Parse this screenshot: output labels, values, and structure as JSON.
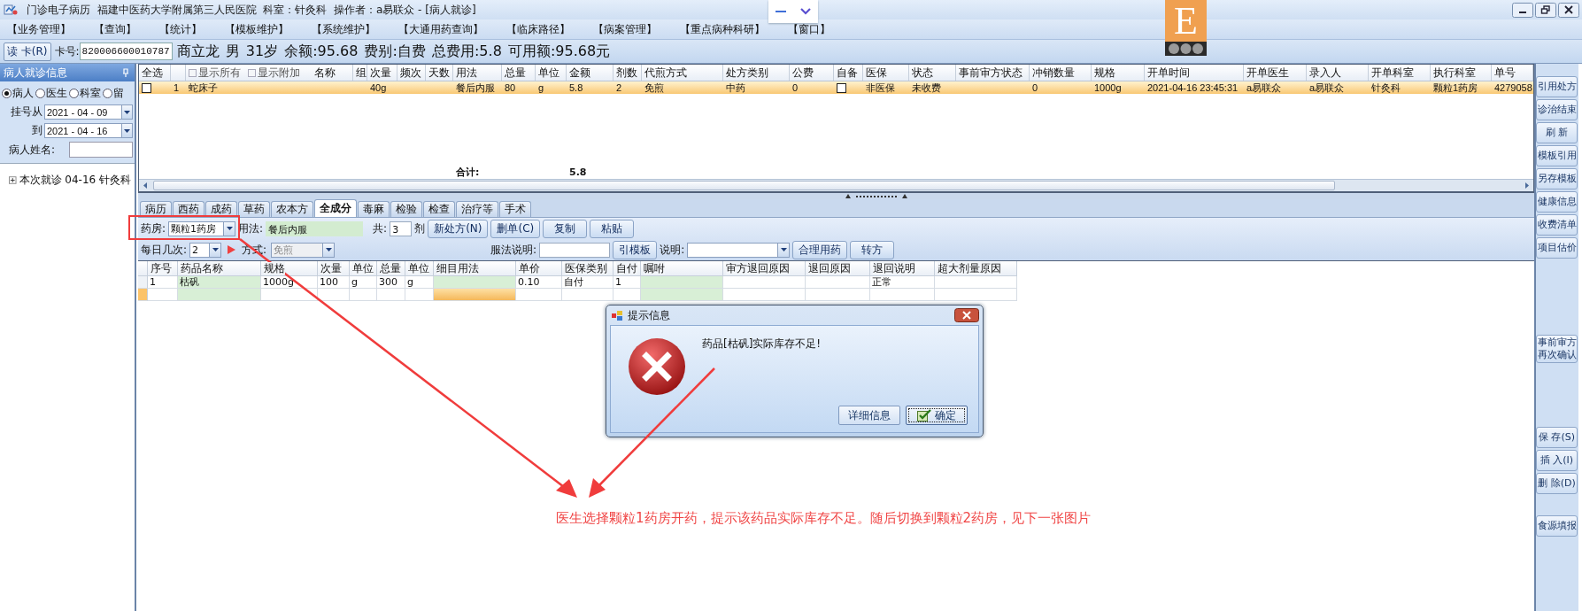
{
  "window": {
    "title": "门诊电子病历  福建中医药大学附属第三人民医院  科室：针灸科  操作者：a易联众 - [病人就诊]"
  },
  "menu": [
    "【业务管理】",
    "【查询】",
    "【统计】",
    "【模板维护】",
    "【系统维护】",
    "【大通用药查询】",
    "【临床路径】",
    "【病案管理】",
    "【重点病种科研】",
    "【窗口】"
  ],
  "logo": {
    "letter": "E"
  },
  "patient_bar": {
    "read_card_button": "读 卡(R)",
    "card_label": "卡号:",
    "card_number": "820006600010787",
    "summary": "商立龙 男 31岁 余额:95.68 费别:自费 总费用:5.8 可用额:95.68元"
  },
  "left_panel": {
    "title": "病人就诊信息",
    "filter": [
      {
        "label": "病人",
        "selected": true
      },
      {
        "label": "医生",
        "selected": false
      },
      {
        "label": "科室",
        "selected": false
      },
      {
        "label": "留",
        "selected": false
      }
    ],
    "date_from_label": "挂号从",
    "date_from": "2021 - 04 - 09",
    "date_to_label": "到",
    "date_to": "2021 - 04 - 16",
    "name_label": "病人姓名:",
    "visits": [
      {
        "label": "本次就诊 04-16 针灸科",
        "expanded": false
      }
    ]
  },
  "orders_table": {
    "header_checkboxes": [
      {
        "label": "显示所有",
        "checked": false
      },
      {
        "label": "显示附加",
        "checked": false
      }
    ],
    "columns": [
      "全选",
      null,
      "名称",
      "组",
      "次量",
      "频次",
      "天数",
      "用法",
      "总量",
      "单位",
      "金额",
      "剂数",
      "代煎方式",
      "处方类别",
      "公费",
      "自备",
      "医保",
      "状态",
      "事前审方状态",
      "冲销数量",
      "规格",
      "开单时间",
      "开单医生",
      "录入人",
      "开单科室",
      "执行科室",
      "单号"
    ],
    "rows": [
      {
        "selected": true,
        "cells": [
          {
            "kind": "checkbox",
            "checked": false
          },
          "1",
          "蛇床子",
          null,
          "40g",
          null,
          null,
          "餐后内服",
          "80",
          "g",
          "5.8",
          "2",
          "免煎",
          "中药",
          "0",
          {
            "kind": "checkbox",
            "checked": false
          },
          "非医保",
          "未收费",
          null,
          "0",
          "1000g",
          "2021-04-16 23:45:31",
          "a易联众",
          "a易联众",
          "针灸科",
          "颗粒1药房",
          "4279058"
        ]
      }
    ],
    "total_label": "合计:",
    "total_amount": "5.8"
  },
  "tabs": [
    {
      "label": "病历",
      "selected": false
    },
    {
      "label": "西药",
      "selected": false
    },
    {
      "label": "成药",
      "selected": false
    },
    {
      "label": "草药",
      "selected": false
    },
    {
      "label": "农本方",
      "selected": false
    },
    {
      "label": "全成分",
      "selected": true
    },
    {
      "label": "毒麻",
      "selected": false
    },
    {
      "label": "检验",
      "selected": false
    },
    {
      "label": "检查",
      "selected": false
    },
    {
      "label": "治疗等",
      "selected": false
    },
    {
      "label": "手术",
      "selected": false
    }
  ],
  "prescription_form": {
    "pharmacy_label": "药房:",
    "pharmacy": "颗粒1药房",
    "usage_label": "用法:",
    "usage": "餐后内服",
    "count_label": "共:",
    "count": "3",
    "count_unit": "剂",
    "buttons": [
      "新处方(N)",
      "删单(C)",
      "复制",
      "粘贴"
    ],
    "times_label": "每日几次:",
    "times": "2",
    "method_label": "方式:",
    "method": "免煎",
    "method_disabled": true,
    "instructions_label": "服法说明:",
    "template_button": "引模板",
    "note_label": "说明:",
    "buttons_2": [
      "合理用药",
      "转方"
    ]
  },
  "items_grid": {
    "columns": [
      "序号",
      "药品名称",
      "规格",
      "次量",
      "单位",
      "总量",
      "单位",
      "细目用法",
      "单价",
      "医保类别",
      "自付",
      "嘱咐",
      "审方退回原因",
      "退回原因",
      "退回说明",
      "超大剂量原因"
    ],
    "rows": [
      {
        "current": false,
        "cells": [
          "1",
          "枯矾",
          "1000g",
          "100",
          "g",
          "300",
          "g",
          null,
          "0.10",
          "自付",
          "1",
          null,
          null,
          null,
          "正常",
          null
        ]
      },
      {
        "current": true,
        "cells": [
          null,
          null,
          null,
          null,
          null,
          null,
          null,
          null,
          null,
          null,
          null,
          null,
          null,
          null,
          null,
          null
        ]
      }
    ]
  },
  "dialog": {
    "title": "提示信息",
    "message": "药品[枯矾]实际库存不足!",
    "buttons": [
      {
        "label": "详细信息",
        "default": false
      },
      {
        "label": "确定",
        "default": true
      }
    ]
  },
  "sidebar": {
    "groups": [
      [
        "引用处方",
        "诊治结束",
        "刷 新",
        "模板引用",
        "另存模板",
        "健康信息",
        "收费清单",
        "项目估价"
      ],
      [
        "事前审方再次确认"
      ],
      [
        "保 存(S)",
        "插 入(I)",
        "删 除(D)"
      ],
      [
        "食源填报"
      ]
    ]
  },
  "annotation": {
    "text": "医生选择颗粒1药房开药，提示该药品实际库存不足。随后切换到颗粒2药房，见下一张图片"
  }
}
